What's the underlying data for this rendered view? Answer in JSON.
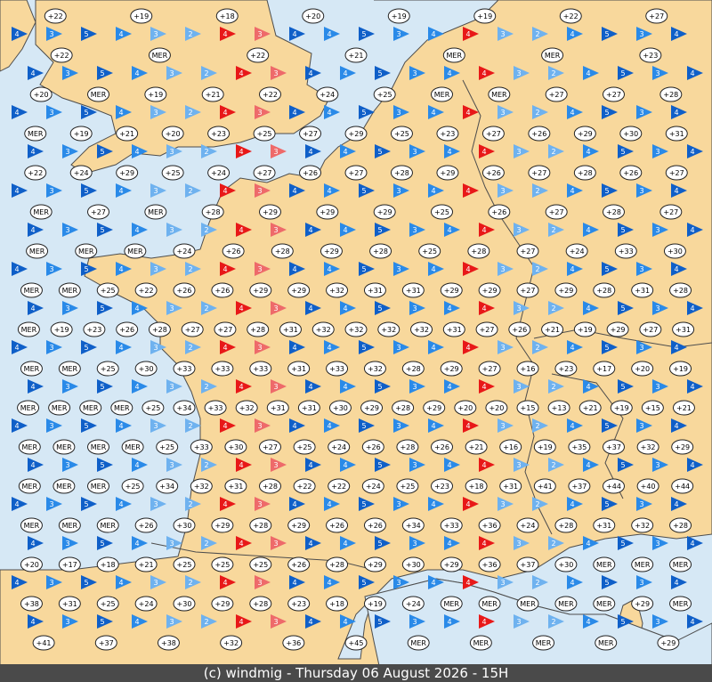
{
  "footer": {
    "text": "(c) windmig - Thursday 06 August 2026 - 15H"
  },
  "colors": {
    "sea": "#d6e8f5",
    "land": "#f8d89c",
    "border": "#4d4d4d",
    "wind_strong": "#0f5fc8",
    "wind_moderate": "#2a8ae8",
    "wind_light": "#6fb2ef",
    "wind_high": "#e81818",
    "wind_high_light": "#ee6a6a"
  },
  "legend_note": "MER",
  "stations": [
    {
      "label": "+22",
      "row": 0
    },
    {
      "label": "+19",
      "row": 0
    },
    {
      "label": "+18",
      "row": 0
    },
    {
      "label": "+20",
      "row": 0
    },
    {
      "label": "+19",
      "row": 0
    },
    {
      "label": "+19",
      "row": 0
    },
    {
      "label": "+22",
      "row": 0
    },
    {
      "label": "+27",
      "row": 0
    },
    {
      "label": "+22",
      "row": 1
    },
    {
      "label": "MER",
      "row": 1
    },
    {
      "label": "+22",
      "row": 1
    },
    {
      "label": "+21",
      "row": 1
    },
    {
      "label": "MER",
      "row": 1
    },
    {
      "label": "MER",
      "row": 1
    },
    {
      "label": "+23",
      "row": 1
    },
    {
      "label": "+20",
      "row": 2
    },
    {
      "label": "MER",
      "row": 2
    },
    {
      "label": "+19",
      "row": 2
    },
    {
      "label": "+21",
      "row": 2
    },
    {
      "label": "+22",
      "row": 2
    },
    {
      "label": "+24",
      "row": 2
    },
    {
      "label": "+25",
      "row": 2
    },
    {
      "label": "MER",
      "row": 2
    },
    {
      "label": "MER",
      "row": 2
    },
    {
      "label": "+27",
      "row": 2
    },
    {
      "label": "+27",
      "row": 2
    },
    {
      "label": "+28",
      "row": 2
    },
    {
      "label": "MER",
      "row": 3
    },
    {
      "label": "+19",
      "row": 3
    },
    {
      "label": "+21",
      "row": 3
    },
    {
      "label": "+20",
      "row": 3
    },
    {
      "label": "+23",
      "row": 3
    },
    {
      "label": "+25",
      "row": 3
    },
    {
      "label": "+27",
      "row": 3
    },
    {
      "label": "+29",
      "row": 3
    },
    {
      "label": "+25",
      "row": 3
    },
    {
      "label": "+23",
      "row": 3
    },
    {
      "label": "+27",
      "row": 3
    },
    {
      "label": "+26",
      "row": 3
    },
    {
      "label": "+29",
      "row": 3
    },
    {
      "label": "+30",
      "row": 3
    },
    {
      "label": "+31",
      "row": 3
    },
    {
      "label": "+22",
      "row": 4
    },
    {
      "label": "+24",
      "row": 4
    },
    {
      "label": "+29",
      "row": 4
    },
    {
      "label": "+25",
      "row": 4
    },
    {
      "label": "+24",
      "row": 4
    },
    {
      "label": "+27",
      "row": 4
    },
    {
      "label": "+26",
      "row": 4
    },
    {
      "label": "+27",
      "row": 4
    },
    {
      "label": "+28",
      "row": 4
    },
    {
      "label": "+29",
      "row": 4
    },
    {
      "label": "+26",
      "row": 4
    },
    {
      "label": "+27",
      "row": 4
    },
    {
      "label": "+28",
      "row": 4
    },
    {
      "label": "+26",
      "row": 4
    },
    {
      "label": "+27",
      "row": 4
    },
    {
      "label": "MER",
      "row": 5
    },
    {
      "label": "+27",
      "row": 5
    },
    {
      "label": "MER",
      "row": 5
    },
    {
      "label": "+28",
      "row": 5
    },
    {
      "label": "+29",
      "row": 5
    },
    {
      "label": "+29",
      "row": 5
    },
    {
      "label": "+29",
      "row": 5
    },
    {
      "label": "+25",
      "row": 5
    },
    {
      "label": "+26",
      "row": 5
    },
    {
      "label": "+27",
      "row": 5
    },
    {
      "label": "+28",
      "row": 5
    },
    {
      "label": "+27",
      "row": 5
    },
    {
      "label": "MER",
      "row": 6
    },
    {
      "label": "MER",
      "row": 6
    },
    {
      "label": "MER",
      "row": 6
    },
    {
      "label": "+24",
      "row": 6
    },
    {
      "label": "+26",
      "row": 6
    },
    {
      "label": "+28",
      "row": 6
    },
    {
      "label": "+29",
      "row": 6
    },
    {
      "label": "+28",
      "row": 6
    },
    {
      "label": "+25",
      "row": 6
    },
    {
      "label": "+28",
      "row": 6
    },
    {
      "label": "+27",
      "row": 6
    },
    {
      "label": "+24",
      "row": 6
    },
    {
      "label": "+33",
      "row": 6
    },
    {
      "label": "+30",
      "row": 6
    },
    {
      "label": "MER",
      "row": 7
    },
    {
      "label": "MER",
      "row": 7
    },
    {
      "label": "+25",
      "row": 7
    },
    {
      "label": "+22",
      "row": 7
    },
    {
      "label": "+26",
      "row": 7
    },
    {
      "label": "+26",
      "row": 7
    },
    {
      "label": "+29",
      "row": 7
    },
    {
      "label": "+29",
      "row": 7
    },
    {
      "label": "+32",
      "row": 7
    },
    {
      "label": "+31",
      "row": 7
    },
    {
      "label": "+31",
      "row": 7
    },
    {
      "label": "+29",
      "row": 7
    },
    {
      "label": "+29",
      "row": 7
    },
    {
      "label": "+27",
      "row": 7
    },
    {
      "label": "+29",
      "row": 7
    },
    {
      "label": "+28",
      "row": 7
    },
    {
      "label": "+31",
      "row": 7
    },
    {
      "label": "+28",
      "row": 7
    },
    {
      "label": "MER",
      "row": 8
    },
    {
      "label": "+19",
      "row": 8
    },
    {
      "label": "+23",
      "row": 8
    },
    {
      "label": "+26",
      "row": 8
    },
    {
      "label": "+28",
      "row": 8
    },
    {
      "label": "+27",
      "row": 8
    },
    {
      "label": "+27",
      "row": 8
    },
    {
      "label": "+28",
      "row": 8
    },
    {
      "label": "+31",
      "row": 8
    },
    {
      "label": "+32",
      "row": 8
    },
    {
      "label": "+32",
      "row": 8
    },
    {
      "label": "+32",
      "row": 8
    },
    {
      "label": "+32",
      "row": 8
    },
    {
      "label": "+31",
      "row": 8
    },
    {
      "label": "+27",
      "row": 8
    },
    {
      "label": "+26",
      "row": 8
    },
    {
      "label": "+21",
      "row": 8
    },
    {
      "label": "+19",
      "row": 8
    },
    {
      "label": "+29",
      "row": 8
    },
    {
      "label": "+27",
      "row": 8
    },
    {
      "label": "+31",
      "row": 8
    },
    {
      "label": "MER",
      "row": 9
    },
    {
      "label": "MER",
      "row": 9
    },
    {
      "label": "+25",
      "row": 9
    },
    {
      "label": "+30",
      "row": 9
    },
    {
      "label": "+33",
      "row": 9
    },
    {
      "label": "+33",
      "row": 9
    },
    {
      "label": "+33",
      "row": 9
    },
    {
      "label": "+31",
      "row": 9
    },
    {
      "label": "+33",
      "row": 9
    },
    {
      "label": "+32",
      "row": 9
    },
    {
      "label": "+28",
      "row": 9
    },
    {
      "label": "+29",
      "row": 9
    },
    {
      "label": "+27",
      "row": 9
    },
    {
      "label": "+16",
      "row": 9
    },
    {
      "label": "+23",
      "row": 9
    },
    {
      "label": "+17",
      "row": 9
    },
    {
      "label": "+20",
      "row": 9
    },
    {
      "label": "+19",
      "row": 9
    },
    {
      "label": "MER",
      "row": 10
    },
    {
      "label": "MER",
      "row": 10
    },
    {
      "label": "MER",
      "row": 10
    },
    {
      "label": "MER",
      "row": 10
    },
    {
      "label": "+25",
      "row": 10
    },
    {
      "label": "+34",
      "row": 10
    },
    {
      "label": "+33",
      "row": 10
    },
    {
      "label": "+32",
      "row": 10
    },
    {
      "label": "+31",
      "row": 10
    },
    {
      "label": "+31",
      "row": 10
    },
    {
      "label": "+30",
      "row": 10
    },
    {
      "label": "+29",
      "row": 10
    },
    {
      "label": "+28",
      "row": 10
    },
    {
      "label": "+29",
      "row": 10
    },
    {
      "label": "+20",
      "row": 10
    },
    {
      "label": "+20",
      "row": 10
    },
    {
      "label": "+15",
      "row": 10
    },
    {
      "label": "+13",
      "row": 10
    },
    {
      "label": "+21",
      "row": 10
    },
    {
      "label": "+19",
      "row": 10
    },
    {
      "label": "+15",
      "row": 10
    },
    {
      "label": "+21",
      "row": 10
    },
    {
      "label": "MER",
      "row": 11
    },
    {
      "label": "MER",
      "row": 11
    },
    {
      "label": "MER",
      "row": 11
    },
    {
      "label": "MER",
      "row": 11
    },
    {
      "label": "+25",
      "row": 11
    },
    {
      "label": "+33",
      "row": 11
    },
    {
      "label": "+30",
      "row": 11
    },
    {
      "label": "+27",
      "row": 11
    },
    {
      "label": "+25",
      "row": 11
    },
    {
      "label": "+24",
      "row": 11
    },
    {
      "label": "+26",
      "row": 11
    },
    {
      "label": "+28",
      "row": 11
    },
    {
      "label": "+26",
      "row": 11
    },
    {
      "label": "+21",
      "row": 11
    },
    {
      "label": "+16",
      "row": 11
    },
    {
      "label": "+19",
      "row": 11
    },
    {
      "label": "+35",
      "row": 11
    },
    {
      "label": "+37",
      "row": 11
    },
    {
      "label": "+32",
      "row": 11
    },
    {
      "label": "+29",
      "row": 11
    },
    {
      "label": "MER",
      "row": 12
    },
    {
      "label": "MER",
      "row": 12
    },
    {
      "label": "MER",
      "row": 12
    },
    {
      "label": "+25",
      "row": 12
    },
    {
      "label": "+34",
      "row": 12
    },
    {
      "label": "+32",
      "row": 12
    },
    {
      "label": "+31",
      "row": 12
    },
    {
      "label": "+28",
      "row": 12
    },
    {
      "label": "+22",
      "row": 12
    },
    {
      "label": "+22",
      "row": 12
    },
    {
      "label": "+24",
      "row": 12
    },
    {
      "label": "+25",
      "row": 12
    },
    {
      "label": "+23",
      "row": 12
    },
    {
      "label": "+18",
      "row": 12
    },
    {
      "label": "+31",
      "row": 12
    },
    {
      "label": "+41",
      "row": 12
    },
    {
      "label": "+37",
      "row": 12
    },
    {
      "label": "+44",
      "row": 12
    },
    {
      "label": "+40",
      "row": 12
    },
    {
      "label": "+44",
      "row": 12
    },
    {
      "label": "MER",
      "row": 13
    },
    {
      "label": "MER",
      "row": 13
    },
    {
      "label": "MER",
      "row": 13
    },
    {
      "label": "+26",
      "row": 13
    },
    {
      "label": "+30",
      "row": 13
    },
    {
      "label": "+29",
      "row": 13
    },
    {
      "label": "+28",
      "row": 13
    },
    {
      "label": "+29",
      "row": 13
    },
    {
      "label": "+26",
      "row": 13
    },
    {
      "label": "+26",
      "row": 13
    },
    {
      "label": "+34",
      "row": 13
    },
    {
      "label": "+33",
      "row": 13
    },
    {
      "label": "+36",
      "row": 13
    },
    {
      "label": "+24",
      "row": 13
    },
    {
      "label": "+28",
      "row": 13
    },
    {
      "label": "+31",
      "row": 13
    },
    {
      "label": "+32",
      "row": 13
    },
    {
      "label": "+28",
      "row": 13
    },
    {
      "label": "+20",
      "row": 14
    },
    {
      "label": "+17",
      "row": 14
    },
    {
      "label": "+18",
      "row": 14
    },
    {
      "label": "+21",
      "row": 14
    },
    {
      "label": "+25",
      "row": 14
    },
    {
      "label": "+25",
      "row": 14
    },
    {
      "label": "+25",
      "row": 14
    },
    {
      "label": "+26",
      "row": 14
    },
    {
      "label": "+28",
      "row": 14
    },
    {
      "label": "+29",
      "row": 14
    },
    {
      "label": "+30",
      "row": 14
    },
    {
      "label": "+29",
      "row": 14
    },
    {
      "label": "+36",
      "row": 14
    },
    {
      "label": "+37",
      "row": 14
    },
    {
      "label": "+30",
      "row": 14
    },
    {
      "label": "MER",
      "row": 14
    },
    {
      "label": "MER",
      "row": 14
    },
    {
      "label": "MER",
      "row": 14
    },
    {
      "label": "+38",
      "row": 15
    },
    {
      "label": "+31",
      "row": 15
    },
    {
      "label": "+25",
      "row": 15
    },
    {
      "label": "+24",
      "row": 15
    },
    {
      "label": "+30",
      "row": 15
    },
    {
      "label": "+29",
      "row": 15
    },
    {
      "label": "+28",
      "row": 15
    },
    {
      "label": "+23",
      "row": 15
    },
    {
      "label": "+18",
      "row": 15
    },
    {
      "label": "+19",
      "row": 15
    },
    {
      "label": "+24",
      "row": 15
    },
    {
      "label": "MER",
      "row": 15
    },
    {
      "label": "MER",
      "row": 15
    },
    {
      "label": "MER",
      "row": 15
    },
    {
      "label": "MER",
      "row": 15
    },
    {
      "label": "MER",
      "row": 15
    },
    {
      "label": "+29",
      "row": 15
    },
    {
      "label": "MER",
      "row": 15
    },
    {
      "label": "+41",
      "row": 16
    },
    {
      "label": "+37",
      "row": 16
    },
    {
      "label": "+38",
      "row": 16
    },
    {
      "label": "+32",
      "row": 16
    },
    {
      "label": "+36",
      "row": 16
    },
    {
      "label": "+45",
      "row": 16
    },
    {
      "label": "MER",
      "row": 16
    },
    {
      "label": "MER",
      "row": 16
    },
    {
      "label": "MER",
      "row": 16
    },
    {
      "label": "MER",
      "row": 16
    },
    {
      "label": "+29",
      "row": 16
    }
  ],
  "arrows": [
    {
      "force": "4",
      "level": "strong"
    },
    {
      "force": "3",
      "level": "moderate"
    },
    {
      "force": "5",
      "level": "strong"
    },
    {
      "force": "4",
      "level": "moderate"
    },
    {
      "force": "3",
      "level": "light"
    },
    {
      "force": "2",
      "level": "light"
    },
    {
      "force": "4",
      "level": "high"
    },
    {
      "force": "3",
      "level": "high_light"
    },
    {
      "force": "4",
      "level": "strong"
    },
    {
      "force": "4",
      "level": "moderate"
    },
    {
      "force": "5",
      "level": "strong"
    },
    {
      "force": "3",
      "level": "moderate"
    },
    {
      "force": "4",
      "level": "moderate"
    },
    {
      "force": "4",
      "level": "high"
    },
    {
      "force": "3",
      "level": "light"
    },
    {
      "force": "2",
      "level": "light"
    },
    {
      "force": "4",
      "level": "moderate"
    },
    {
      "force": "5",
      "level": "strong"
    },
    {
      "force": "3",
      "level": "moderate"
    },
    {
      "force": "4",
      "level": "strong"
    }
  ]
}
